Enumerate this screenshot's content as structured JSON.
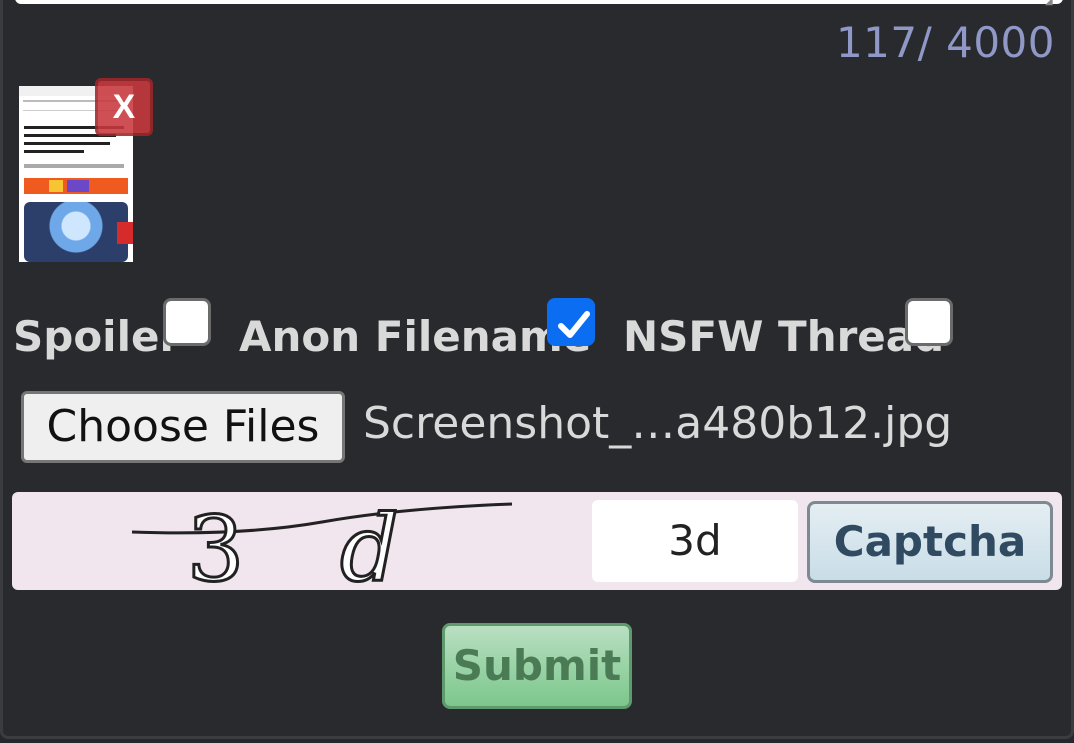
{
  "form": {
    "char_count": "117/ 4000",
    "attachment": {
      "remove_label": "X"
    },
    "options": {
      "spoiler_label": "Spoiler",
      "spoiler_checked": false,
      "anon_filename_label": "Anon Filename",
      "anon_filename_checked": true,
      "nsfw_label": "NSFW Thread",
      "nsfw_checked": false
    },
    "file_picker": {
      "button_label": "Choose Files",
      "file_name": "Screenshot_…a480b12.jpg"
    },
    "captcha": {
      "challenge_text": "3d",
      "input_value": "3d",
      "button_label": "Captcha"
    },
    "submit_label": "Submit"
  },
  "colors": {
    "background": "#282a2e",
    "char_count": "#8f98c6",
    "checkbox_checked": "#0b6ef2",
    "remove_button": "#c9383d",
    "captcha_bg": "#f1e5ee",
    "submit_bg": "#7cc78c"
  },
  "icons": {
    "remove": "close-icon",
    "check": "checkmark-icon"
  }
}
